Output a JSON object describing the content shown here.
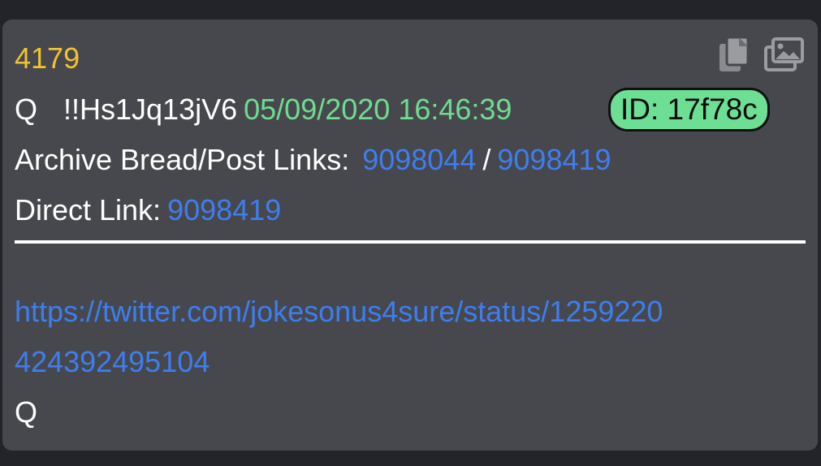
{
  "post": {
    "number": "4179",
    "author": "Q",
    "tripcode": "!!Hs1Jq13jV6",
    "datetime": "05/09/2020 16:46:39",
    "id_badge": "ID: 17f78c",
    "archive_label": "Archive Bread/Post Links:",
    "archive_bread_link": "9098044",
    "archive_separator": "/",
    "archive_post_link": "9098419",
    "direct_label": "Direct Link:",
    "direct_link": "9098419",
    "body_link_line1": "https://twitter.com/jokesonus4sure/status/1259220",
    "body_link_line2": "424392495104",
    "signature": "Q"
  },
  "toolbar": {
    "copy_icon": "copy-icon",
    "images_icon": "images-icon"
  },
  "colors": {
    "card_background": "#47484d",
    "page_background": "#232429",
    "post_number": "#f2c230",
    "date": "#6fdc8f",
    "link": "#3d7ef0",
    "id_badge": "#6ddf95",
    "text": "#ffffff"
  }
}
